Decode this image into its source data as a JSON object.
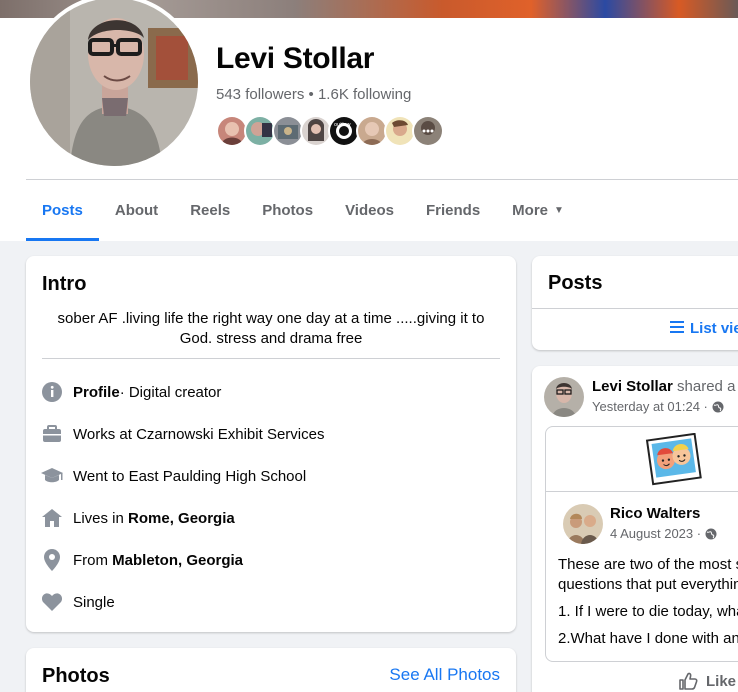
{
  "profile": {
    "name": "Levi Stollar",
    "follow_stats": "543 followers • 1.6K following"
  },
  "tabs": [
    {
      "label": "Posts",
      "active": true
    },
    {
      "label": "About"
    },
    {
      "label": "Reels"
    },
    {
      "label": "Photos"
    },
    {
      "label": "Videos"
    },
    {
      "label": "Friends"
    },
    {
      "label": "More"
    }
  ],
  "intro": {
    "title": "Intro",
    "bio": "sober AF .living life the right way one day at a time .....giving it to God. stress and drama free",
    "details": [
      {
        "icon": "info-icon",
        "bold": "Profile",
        "text": " · Digital creator"
      },
      {
        "icon": "briefcase-icon",
        "text": "Works at Czarnowski Exhibit Services"
      },
      {
        "icon": "graduation-cap-icon",
        "text": "Went to East Paulding High School"
      },
      {
        "icon": "home-icon",
        "text": "Lives in ",
        "bold": "Rome, Georgia"
      },
      {
        "icon": "location-pin-icon",
        "text": "From ",
        "bold": "Mableton, Georgia"
      },
      {
        "icon": "heart-icon",
        "text": "Single"
      }
    ]
  },
  "photos": {
    "title": "Photos",
    "see_all": "See All Photos"
  },
  "posts_panel": {
    "title": "Posts",
    "list_view": "List vie"
  },
  "post": {
    "author": "Levi Stollar",
    "action": "shared a m",
    "time": "Yesterday at 01:24 ·",
    "shared": {
      "author": "Rico Walters",
      "time": "4 August 2023 ·",
      "lines": [
        "These are two of the most s",
        "questions that put everythin",
        "1. If I were to die today, wha",
        "2.What have I done with an"
      ]
    },
    "like": "Like"
  },
  "colors": {
    "accent": "#1877f2",
    "secondary_text": "#65676b",
    "background": "#f0f2f5"
  }
}
